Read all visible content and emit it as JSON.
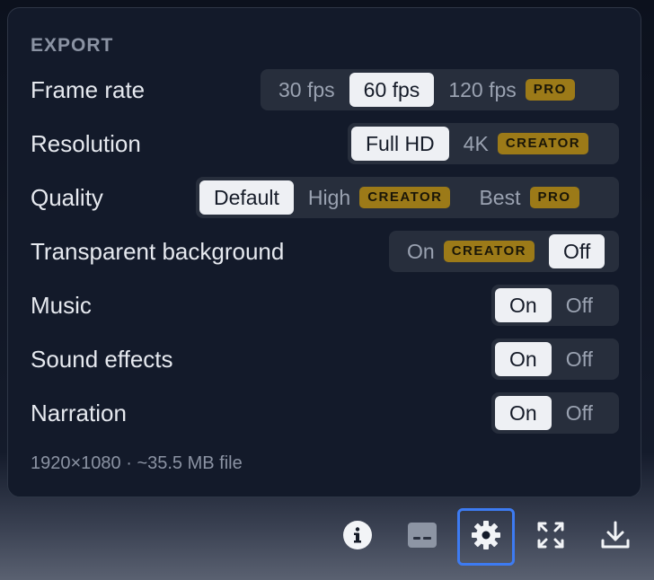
{
  "export": {
    "section_title": "EXPORT",
    "rows": [
      {
        "label": "Frame rate",
        "options": [
          {
            "label": "30 fps",
            "badge": null,
            "active": false
          },
          {
            "label": "60 fps",
            "badge": null,
            "active": true
          },
          {
            "label": "120 fps",
            "badge": "PRO",
            "active": false
          }
        ]
      },
      {
        "label": "Resolution",
        "options": [
          {
            "label": "Full HD",
            "badge": null,
            "active": true
          },
          {
            "label": "4K",
            "badge": "CREATOR",
            "active": false
          }
        ]
      },
      {
        "label": "Quality",
        "options": [
          {
            "label": "Default",
            "badge": null,
            "active": true
          },
          {
            "label": "High",
            "badge": "CREATOR",
            "active": false
          },
          {
            "label": "Best",
            "badge": "PRO",
            "active": false
          }
        ]
      },
      {
        "label": "Transparent background",
        "options": [
          {
            "label": "On",
            "badge": "CREATOR",
            "active": false
          },
          {
            "label": "Off",
            "badge": null,
            "active": true
          }
        ]
      },
      {
        "label": "Music",
        "options": [
          {
            "label": "On",
            "badge": null,
            "active": true
          },
          {
            "label": "Off",
            "badge": null,
            "active": false
          }
        ]
      },
      {
        "label": "Sound effects",
        "options": [
          {
            "label": "On",
            "badge": null,
            "active": true
          },
          {
            "label": "Off",
            "badge": null,
            "active": false
          }
        ]
      },
      {
        "label": "Narration",
        "options": [
          {
            "label": "On",
            "badge": null,
            "active": true
          },
          {
            "label": "Off",
            "badge": null,
            "active": false
          }
        ]
      }
    ],
    "summary": "1920×1080 · ~35.5 MB file"
  },
  "toolbar": {
    "buttons": [
      {
        "icon": "info-icon",
        "selected": false
      },
      {
        "icon": "subtitles-icon",
        "selected": false
      },
      {
        "icon": "gear-icon",
        "selected": true
      },
      {
        "icon": "fullscreen-icon",
        "selected": false
      },
      {
        "icon": "download-icon",
        "selected": false
      }
    ]
  },
  "colors": {
    "panel_bg": "#131a2a",
    "segment_bg": "#272e3c",
    "active_option_bg": "#eef0f4",
    "badge_bg": "#9c7a18",
    "selected_button_border": "#3d7bf2"
  }
}
